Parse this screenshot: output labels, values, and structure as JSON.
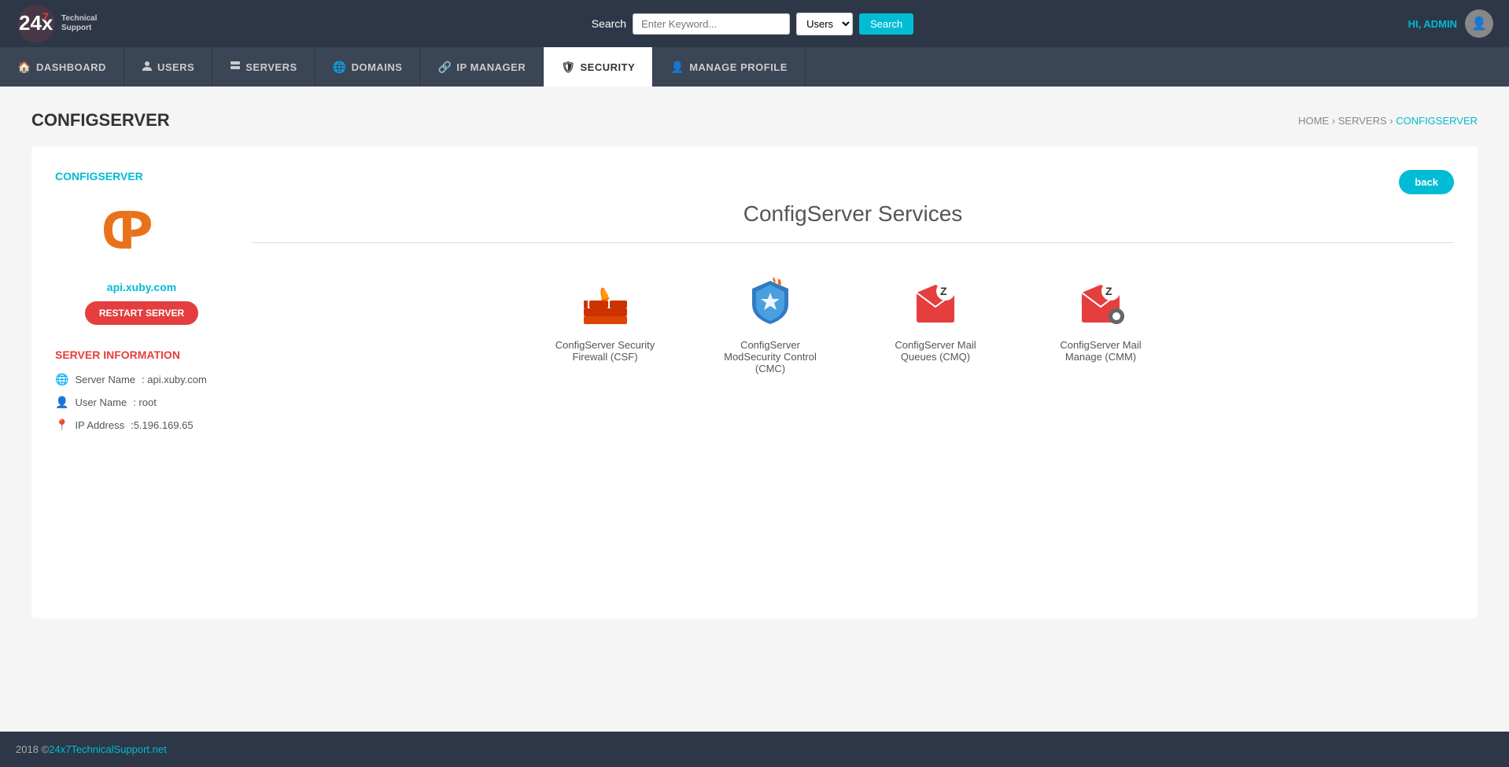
{
  "header": {
    "brand": "24x7 Technical Support",
    "brand_num": "24x",
    "brand_num2": "7",
    "search_label": "Search",
    "search_placeholder": "Enter Keyword...",
    "search_select_default": "Users",
    "search_btn": "Search",
    "hi_admin": "HI, ADMIN"
  },
  "nav": {
    "items": [
      {
        "label": "DASHBOARD",
        "icon": "🏠",
        "active": false
      },
      {
        "label": "USERS",
        "icon": "🛡",
        "active": false
      },
      {
        "label": "SERVERS",
        "icon": "🛡",
        "active": false
      },
      {
        "label": "DOMAINS",
        "icon": "🛡",
        "active": false
      },
      {
        "label": "IP MANAGER",
        "icon": "🛡",
        "active": false
      },
      {
        "label": "SECURITY",
        "icon": "🛡",
        "active": true
      },
      {
        "label": "MANAGE PROFILE",
        "icon": "🛡",
        "active": false
      }
    ]
  },
  "page": {
    "title": "CONFIGSERVER",
    "breadcrumb_home": "HOME",
    "breadcrumb_servers": "SERVERS",
    "breadcrumb_current": "CONFIGSERVER",
    "back_btn": "back"
  },
  "left_panel": {
    "link_label": "CONFIGSERVER",
    "server_hostname": "api.xuby.com",
    "restart_btn": "RESTART SERVER",
    "server_info_title": "SERVER INFORMATION",
    "server_name_label": "Server Name",
    "server_name_value": ": api.xuby.com",
    "user_name_label": "User Name",
    "user_name_value": ": root",
    "ip_label": "IP Address",
    "ip_value": ":5.196.169.65"
  },
  "services": {
    "section_title": "ConfigServer Services",
    "items": [
      {
        "label": "ConfigServer Security Firewall (CSF)",
        "icon_type": "firewall"
      },
      {
        "label": "ConfigServer ModSecurity Control (CMC)",
        "icon_type": "shield"
      },
      {
        "label": "ConfigServer Mail Queues (CMQ)",
        "icon_type": "mailq"
      },
      {
        "label": "ConfigServer Mail Manage (CMM)",
        "icon_type": "mailm"
      }
    ]
  },
  "footer": {
    "copyright": "2018 © ",
    "link_text": "24x7TechnicalSupport.net"
  }
}
